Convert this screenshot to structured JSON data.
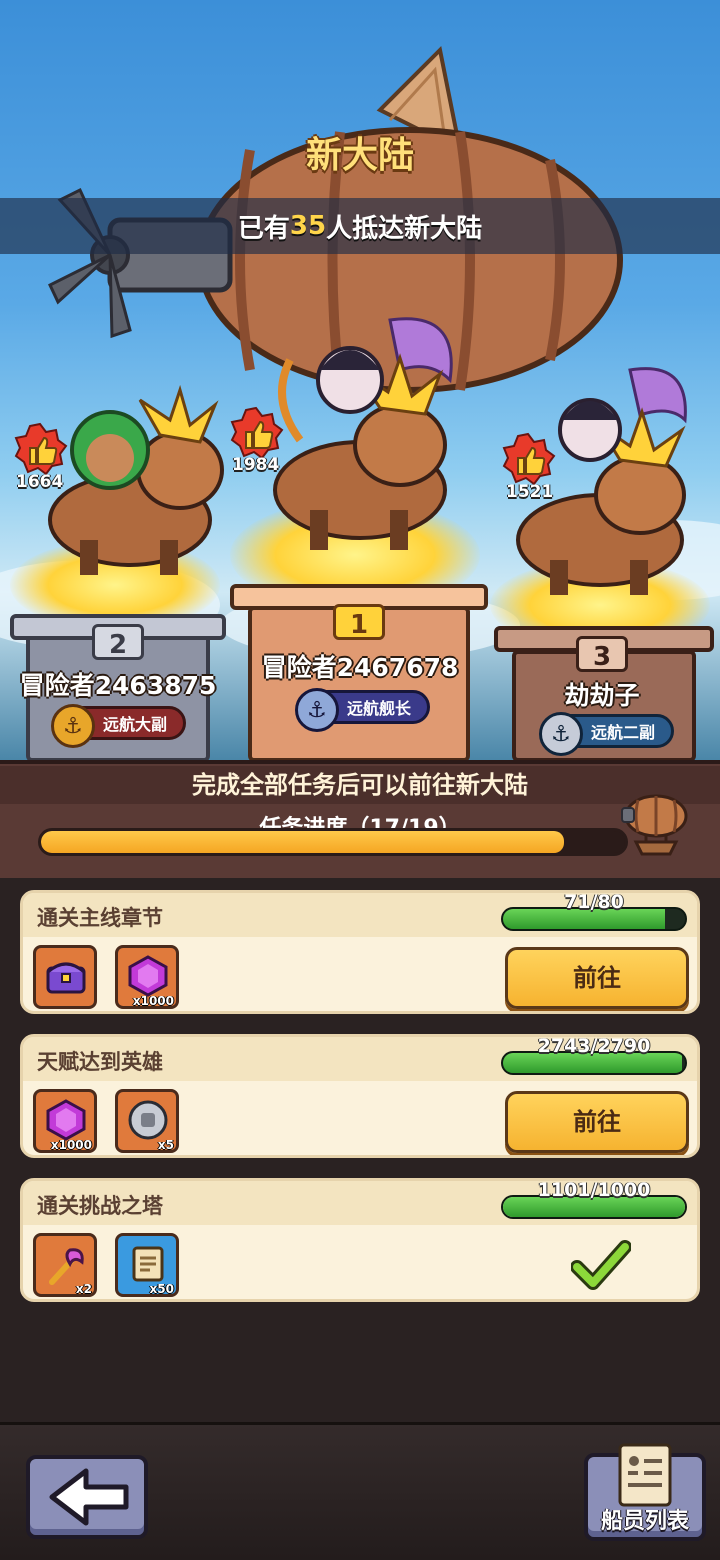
{
  "header": {
    "title": "新大陆",
    "arrival_prefix": "已有",
    "arrival_count": "35",
    "arrival_suffix": "人抵达新大陆"
  },
  "podium": [
    {
      "rank": "1",
      "name": "冒险者2467678",
      "badge": "远航舰长",
      "likes": "1984"
    },
    {
      "rank": "2",
      "name": "冒险者2463875",
      "badge": "远航大副",
      "likes": "1664"
    },
    {
      "rank": "3",
      "name": "劫劫子",
      "badge": "远航二副",
      "likes": "1521"
    }
  ],
  "progress": {
    "notice": "完成全部任务后可以前往新大陆",
    "label": "任务进度（17/19）",
    "done": 17,
    "total": 19
  },
  "tasks": [
    {
      "title": "通关主线章节",
      "progress_text": "71/80",
      "fraction": 0.8875,
      "rewards": [
        {
          "icon": "treasure-chest-icon",
          "count": ""
        },
        {
          "icon": "purple-gem-icon",
          "count": "x1000"
        }
      ],
      "action": "前往",
      "completed": false
    },
    {
      "title": "天赋达到英雄",
      "progress_text": "2743/2790",
      "fraction": 0.983,
      "rewards": [
        {
          "icon": "purple-gem-icon",
          "count": "x1000"
        },
        {
          "icon": "silver-coin-icon",
          "count": "x5"
        }
      ],
      "action": "前往",
      "completed": false
    },
    {
      "title": "通关挑战之塔",
      "progress_text": "1101/1000",
      "fraction": 1.0,
      "rewards": [
        {
          "icon": "magic-scepter-icon",
          "count": "x2"
        },
        {
          "icon": "scroll-icon",
          "count": "x50"
        }
      ],
      "action": "",
      "completed": true
    }
  ],
  "footer": {
    "crew_label": "船员列表"
  },
  "colors": {
    "accent_gold": "#ffd54a",
    "progress_orange": "#f5a623",
    "task_green": "#3fb03a",
    "button_yellow": "#f6b330"
  }
}
